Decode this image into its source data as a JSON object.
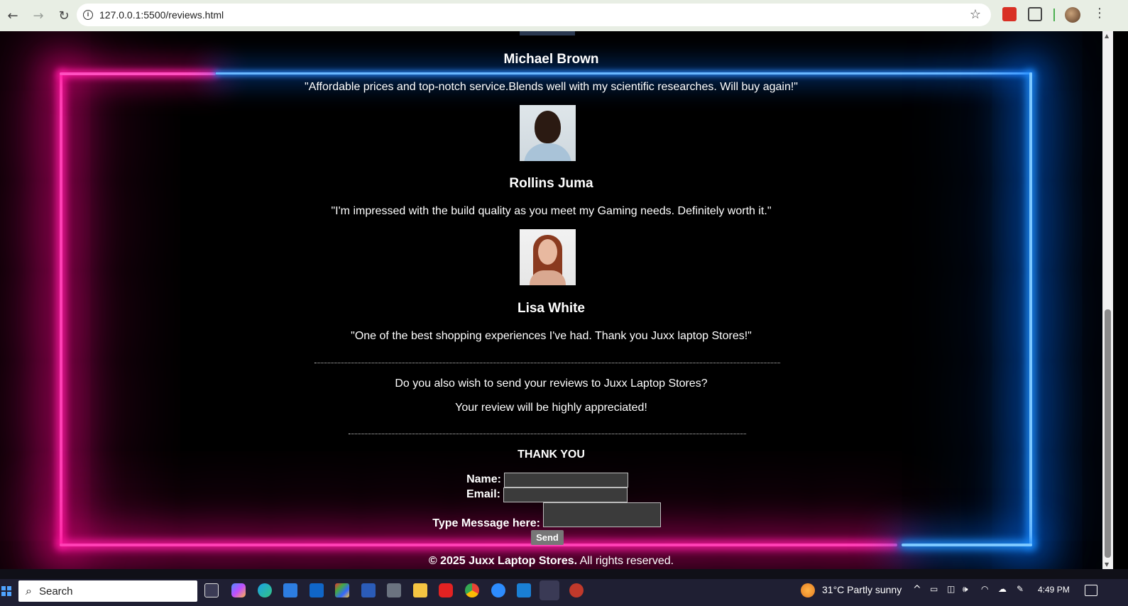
{
  "browser": {
    "url": "127.0.0.1:5500/reviews.html",
    "back_icon": "back-arrow-icon",
    "forward_icon": "forward-arrow-icon",
    "reload_icon": "reload-icon"
  },
  "reviews": [
    {
      "name": "Michael Brown",
      "quote": "\"Affordable prices and top-notch service.Blends well with my scientific researches. Will buy again!\""
    },
    {
      "name": "Rollins Juma",
      "quote": "\"I'm impressed with the build quality as you meet my Gaming needs. Definitely worth it.\""
    },
    {
      "name": "Lisa White",
      "quote": "\"One of the best shopping experiences I've had. Thank you Juxx laptop Stores!\""
    }
  ],
  "cta": {
    "line1": "Do you also wish to send your reviews to Juxx Laptop Stores?",
    "line2": "Your review will be highly appreciated!"
  },
  "form": {
    "heading": "THANK YOU",
    "name_label": "Name:",
    "email_label": "Email:",
    "message_label": "Type Message here:",
    "name_value": "",
    "email_value": "",
    "message_value": "",
    "send_label": "Send"
  },
  "footer": {
    "copyright": "© 2025 Juxx Laptop Stores.",
    "rights": " All rights reserved."
  },
  "taskbar": {
    "search_placeholder": "Search",
    "weather": "31°C  Partly sunny",
    "time": "4:49 PM"
  },
  "colors": {
    "neon_pink": "#ff1aa3",
    "neon_blue": "#1e90ff",
    "page_bg": "#000000"
  }
}
